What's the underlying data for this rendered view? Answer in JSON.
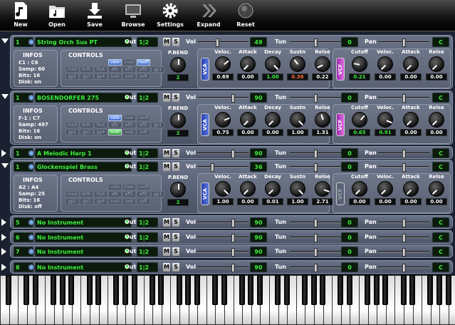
{
  "toolbar": {
    "new": "New",
    "open": "Open",
    "save": "Save",
    "browse": "Browse",
    "settings": "Settings",
    "expand": "Expand",
    "reset": "Reset"
  },
  "labels": {
    "out": "Out",
    "mute": "M",
    "solo": "S",
    "vol": "Vol",
    "tun": "Tun",
    "pan": "Pan",
    "infos": "INFOS",
    "controls": "CONTROLS",
    "pbend": "P.BEND",
    "vca": "VCA",
    "vcf": "VCF",
    "veloc": "Veloc.",
    "attack": "Attack",
    "decay": "Decay",
    "sustn": "Sustn",
    "relse": "Relse",
    "cutoff": "Cutoff",
    "ctl": [
      "mod",
      "brth",
      "foot",
      "velo",
      "aftr",
      "eff1",
      "eff2",
      "gp1",
      "gp2",
      "gp3",
      "gp4",
      "sust",
      "sost",
      "soft",
      "kswi",
      "nsoff"
    ]
  },
  "slots": [
    {
      "channel": "1",
      "instrument": "String Orch Sus PT",
      "out": "1|2",
      "vol": "49",
      "tun": "0",
      "pan": "C",
      "vol_level": 0.38,
      "expanded": true,
      "infos": [
        "C1 : C6",
        "Samp: 60",
        "Bits: 16",
        "Disk: on"
      ],
      "pbend": "2",
      "vca": [
        "0.69",
        "0.00",
        "1.00",
        "0.36",
        "0.22"
      ],
      "vcf": [
        "0.21",
        "0.00",
        "0.00",
        "0.00"
      ],
      "vcf_on": true,
      "active_ctl": [
        "velo",
        "nsoff"
      ]
    },
    {
      "channel": "1",
      "instrument": "BOSENDORFER 275",
      "out": "1|2",
      "vol": "90",
      "tun": "0",
      "pan": "C",
      "vol_level": 0.71,
      "expanded": true,
      "infos": [
        "F-1 : C7",
        "Samp: 497",
        "Bits: 16",
        "Disk: on"
      ],
      "pbend": "2",
      "vca": [
        "0.75",
        "0.00",
        "0.00",
        "1.00",
        "1.31"
      ],
      "vcf": [
        "0.65",
        "0.91",
        "0.00",
        "0.00"
      ],
      "vcf_on": true,
      "active_ctl": [
        "velo",
        "sust"
      ]
    },
    {
      "channel": "1",
      "instrument": "A Melodic Harp 1",
      "out": "1|2",
      "vol": "90",
      "tun": "0",
      "pan": "C",
      "vol_level": 0.71,
      "expanded": false
    },
    {
      "channel": "1",
      "instrument": "Glockenspiel Brass",
      "out": "1|2",
      "vol": "36",
      "tun": "0",
      "pan": "C",
      "vol_level": 0.28,
      "expanded": true,
      "infos": [
        "A2 : A4",
        "Samp: 25",
        "Bits: 16",
        "Disk: off"
      ],
      "pbend": "2",
      "vca": [
        "1.00",
        "0.00",
        "0.01",
        "1.00",
        "2.71"
      ],
      "vcf": [
        "0.00",
        "0.00",
        "0.00",
        "0.00"
      ],
      "vcf_on": false,
      "active_ctl": []
    },
    {
      "channel": "5",
      "instrument": "No Instrument",
      "out": "1|2",
      "vol": "90",
      "tun": "0",
      "pan": "C",
      "vol_level": 0.71,
      "expanded": false
    },
    {
      "channel": "6",
      "instrument": "No Instrument",
      "out": "1|2",
      "vol": "90",
      "tun": "0",
      "pan": "C",
      "vol_level": 0.71,
      "expanded": false
    },
    {
      "channel": "7",
      "instrument": "No Instrument",
      "out": "1|2",
      "vol": "90",
      "tun": "0",
      "pan": "C",
      "vol_level": 0.71,
      "expanded": false
    },
    {
      "channel": "8",
      "instrument": "No Instrument",
      "out": "1|2",
      "vol": "90",
      "tun": "0",
      "pan": "C",
      "vol_level": 0.71,
      "expanded": false
    }
  ]
}
